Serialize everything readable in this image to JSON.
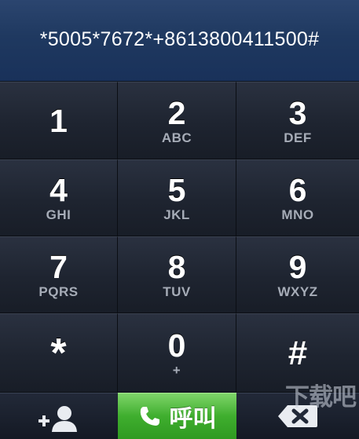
{
  "display": {
    "number": "*5005*7672*+8613800411500#"
  },
  "keypad": [
    {
      "digit": "1",
      "letters": ""
    },
    {
      "digit": "2",
      "letters": "ABC"
    },
    {
      "digit": "3",
      "letters": "DEF"
    },
    {
      "digit": "4",
      "letters": "GHI"
    },
    {
      "digit": "5",
      "letters": "JKL"
    },
    {
      "digit": "6",
      "letters": "MNO"
    },
    {
      "digit": "7",
      "letters": "PQRS"
    },
    {
      "digit": "8",
      "letters": "TUV"
    },
    {
      "digit": "9",
      "letters": "WXYZ"
    },
    {
      "digit": "*",
      "letters": ""
    },
    {
      "digit": "0",
      "letters": "+"
    },
    {
      "digit": "#",
      "letters": ""
    }
  ],
  "bottom_bar": {
    "call_label": "呼叫",
    "add_contact_icon": "add-contact-icon",
    "delete_icon": "backspace-icon",
    "call_icon": "phone-icon"
  },
  "watermark": "下载吧",
  "colors": {
    "call_green": "#3fae2e",
    "display_blue": "#1f3960"
  }
}
